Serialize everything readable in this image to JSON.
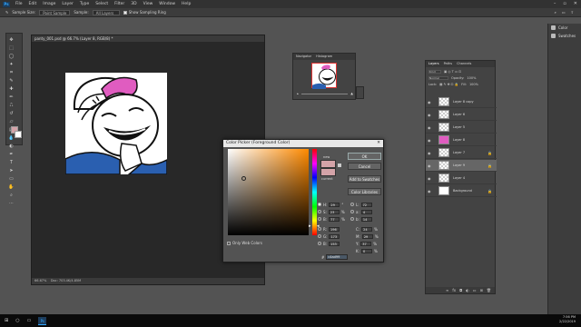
{
  "menu": {
    "items": [
      "File",
      "Edit",
      "Image",
      "Layer",
      "Type",
      "Select",
      "Filter",
      "3D",
      "View",
      "Window",
      "Help"
    ]
  },
  "options": {
    "sample_size_label": "Sample Size:",
    "sample_size_value": "Point Sample",
    "sample_label": "Sample:",
    "sample_value": "All Layers",
    "show_ring_label": "Show Sampling Ring"
  },
  "document": {
    "tab_title": "panty_001.psd @ 66.7% (Layer 8, RGB/8) *",
    "status_zoom": "66.67%",
    "status_doc": "Doc: 703.4K/4.85M"
  },
  "navigator": {
    "tabs": [
      "Navigator",
      "Histogram"
    ],
    "zoom": "66.67%"
  },
  "color_picker": {
    "title": "Color Picker (Foreground Color)",
    "new_label": "new",
    "current_label": "current",
    "buttons": {
      "ok": "OK",
      "cancel": "Cancel",
      "add_swatches": "Add to Swatches",
      "libraries": "Color Libraries"
    },
    "only_web": "Only Web Colors",
    "hsb": [
      {
        "label": "H:",
        "value": "29",
        "unit": "°"
      },
      {
        "label": "S:",
        "value": "23",
        "unit": "%"
      },
      {
        "label": "B:",
        "value": "77",
        "unit": "%"
      }
    ],
    "rgb": [
      {
        "label": "R:",
        "value": "196"
      },
      {
        "label": "G:",
        "value": "173"
      },
      {
        "label": "B:",
        "value": "153"
      }
    ],
    "lab": [
      {
        "label": "L:",
        "value": "72"
      },
      {
        "label": "a:",
        "value": "4"
      },
      {
        "label": "b:",
        "value": "14"
      }
    ],
    "cmyk": [
      {
        "label": "C:",
        "value": "24",
        "unit": "%"
      },
      {
        "label": "M:",
        "value": "29",
        "unit": "%"
      },
      {
        "label": "Y:",
        "value": "37",
        "unit": "%"
      },
      {
        "label": "K:",
        "value": "0",
        "unit": "%"
      }
    ],
    "hex_label": "#",
    "hex_value": "c4ad99",
    "new_color": "#d4a3a8"
  },
  "layers_panel": {
    "tabs": [
      "Layers",
      "Paths",
      "Channels"
    ],
    "kind_label": "Kind",
    "mode": "Normal",
    "opacity_label": "Opacity:",
    "opacity": "100%",
    "lock_label": "Lock:",
    "fill_label": "Fill:",
    "fill": "100%",
    "layers": [
      {
        "name": "Layer 8 copy",
        "selected": false,
        "locked": false
      },
      {
        "name": "Layer 6",
        "selected": false,
        "locked": false
      },
      {
        "name": "Layer 5",
        "selected": false,
        "locked": false
      },
      {
        "name": "Layer 8",
        "selected": false,
        "locked": false
      },
      {
        "name": "Layer 7",
        "selected": false,
        "locked": true
      },
      {
        "name": "Layer 9",
        "selected": true,
        "locked": true
      },
      {
        "name": "Layer 4",
        "selected": false,
        "locked": false
      },
      {
        "name": "Background",
        "selected": false,
        "locked": true
      }
    ]
  },
  "right_panel": {
    "items": [
      "Color",
      "Swatches"
    ]
  },
  "taskbar": {
    "time": "7:56 PM",
    "date": "2/22/2019"
  }
}
